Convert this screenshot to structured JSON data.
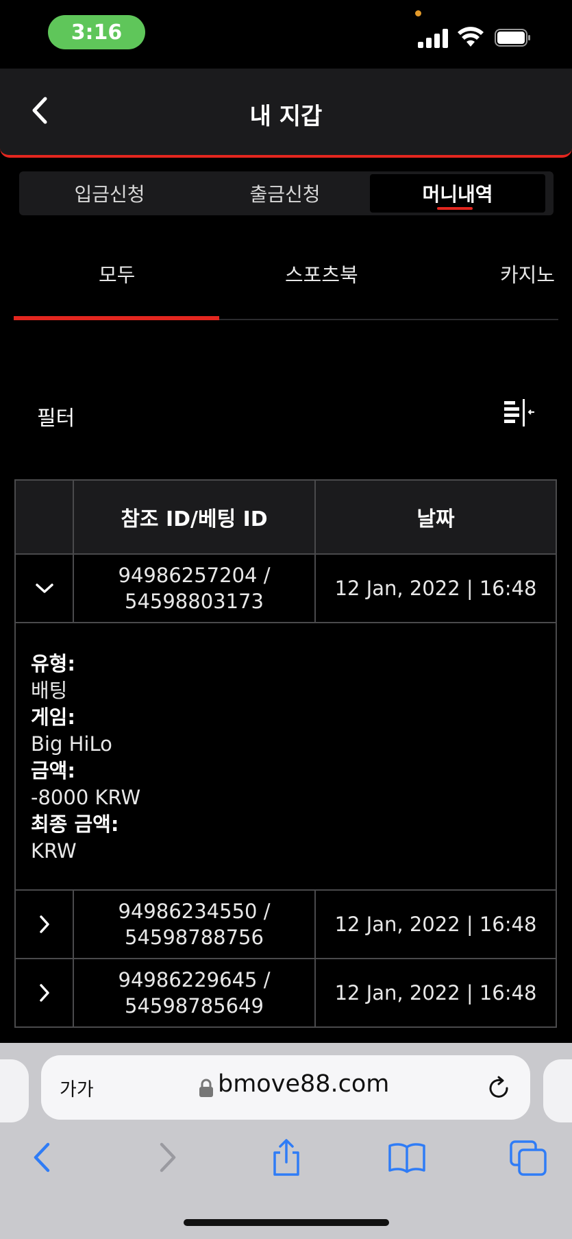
{
  "status": {
    "time": "3:16"
  },
  "header": {
    "title": "내 지갑"
  },
  "segments": [
    {
      "label": "입금신청",
      "active": false
    },
    {
      "label": "출금신청",
      "active": false
    },
    {
      "label": "머니내역",
      "active": true
    }
  ],
  "subtabs": [
    {
      "label": "모두",
      "active": true
    },
    {
      "label": "스포츠북",
      "active": false
    },
    {
      "label": "카지노",
      "active": false
    }
  ],
  "filter": {
    "label": "필터"
  },
  "table": {
    "headers": [
      "",
      "참조 ID/베팅 ID",
      "날짜"
    ],
    "rows": [
      {
        "ref": "94986257204 /",
        "bet": "54598803173",
        "date": "12 Jan, 2022 | 16:48",
        "expanded": true
      },
      {
        "ref": "94986234550 /",
        "bet": "54598788756",
        "date": "12 Jan, 2022 | 16:48",
        "expanded": false
      },
      {
        "ref": "94986229645 /",
        "bet": "54598785649",
        "date": "12 Jan, 2022 | 16:48",
        "expanded": false
      }
    ],
    "detail": {
      "type_label": "유형:",
      "type_value": "배팅",
      "game_label": "게임:",
      "game_value": "Big HiLo",
      "amount_label": "금액:",
      "amount_value": "-8000 KRW",
      "final_label": "최종 금액:",
      "final_value": "KRW"
    }
  },
  "browser": {
    "text_size": "가가",
    "url": "bmove88.com"
  },
  "colors": {
    "accent": "#e3261f",
    "header_bg": "#1b1b1d",
    "browser_bg": "#c9c9cd",
    "ios_blue": "#2f7cf6"
  }
}
